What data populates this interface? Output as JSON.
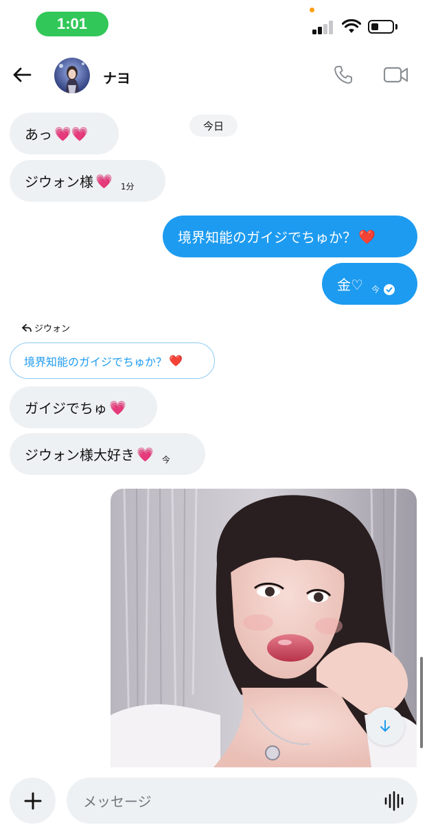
{
  "status_bar": {
    "time": "1:01",
    "signal_level": 2,
    "battery_level": 0.3
  },
  "header": {
    "contact_name": "ナヨ"
  },
  "date_divider": "今日",
  "messages": [
    {
      "direction": "in",
      "text": "あっ",
      "heart": "💗💗",
      "meta": ""
    },
    {
      "direction": "in",
      "text": "ジウォン様",
      "heart": "💗",
      "meta": "1分"
    },
    {
      "direction": "out",
      "text": "境界知能のガイジでちゅか？",
      "heart": "❤️",
      "meta": ""
    },
    {
      "direction": "out",
      "text": "金♡",
      "heart": "",
      "meta": "今"
    },
    {
      "direction": "in",
      "text": "ガイジでちゅ",
      "heart": "💗",
      "meta": ""
    },
    {
      "direction": "in",
      "text": "ジウォン様大好き",
      "heart": "💗",
      "meta": "今"
    }
  ],
  "reply": {
    "label": "ジウォン",
    "quoted_text": "境界知能のガイジでちゅか？",
    "quoted_heart": "❤️"
  },
  "composer": {
    "placeholder": "メッセージ"
  },
  "icons": {
    "back": "arrow-left",
    "call": "phone-outline",
    "video": "video-camera-outline",
    "scroll": "arrow-down",
    "add": "plus",
    "voice": "waveform"
  },
  "colors": {
    "accent": "#1d9bf0",
    "incoming_bubble": "#eef1f3",
    "time_pill": "#32c759"
  }
}
